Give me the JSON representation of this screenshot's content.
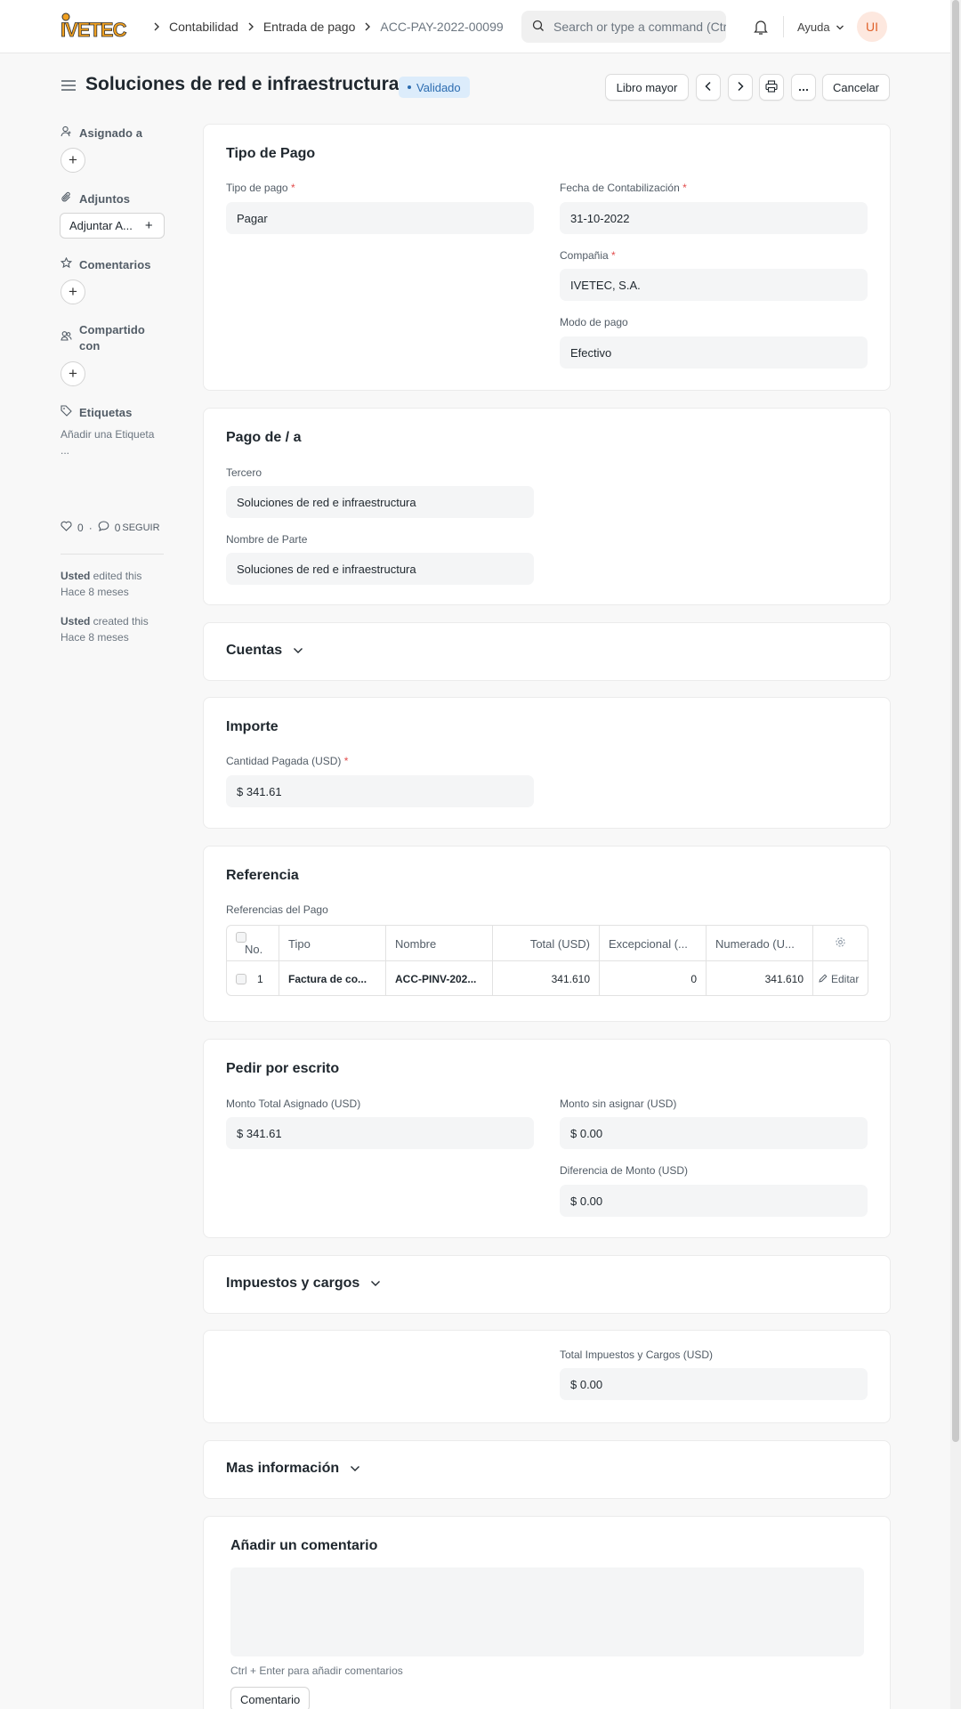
{
  "navbar": {
    "logo_text": "IVETEC",
    "breadcrumbs": [
      "Contabilidad",
      "Entrada de pago",
      "ACC-PAY-2022-00099"
    ],
    "search_placeholder": "Search or type a command (Ctrl + G)",
    "help_label": "Ayuda",
    "avatar_initials": "UI"
  },
  "header": {
    "title": "Soluciones de red e infraestructura",
    "status": "Validado",
    "ledger_button": "Libro mayor",
    "cancel_button": "Cancelar"
  },
  "sidebar": {
    "assigned_label": "Asignado a",
    "attachments_label": "Adjuntos",
    "attach_button": "Adjuntar A...",
    "comments_label": "Comentarios",
    "shared_label_1": "Compartido",
    "shared_label_2": "con",
    "tags_label": "Etiquetas",
    "add_tag_1": "Añadir una Etiqueta",
    "add_tag_2": "...",
    "likes": "0",
    "comments_count": "0",
    "follow": "SEGUIR",
    "activity": [
      {
        "who": "Usted",
        "what": " edited this",
        "when": "Hace 8 meses"
      },
      {
        "who": "Usted",
        "what": " created this",
        "when": "Hace 8 meses"
      }
    ]
  },
  "payment_type": {
    "title": "Tipo de Pago",
    "payment_type_label": "Tipo de pago",
    "payment_type_value": "Pagar",
    "posting_date_label": "Fecha de Contabilización",
    "posting_date_value": "31-10-2022",
    "company_label": "Compañia",
    "company_value": "IVETEC, S.A.",
    "mode_label": "Modo de pago",
    "mode_value": "Efectivo"
  },
  "party": {
    "title": "Pago de / a",
    "third_label": "Tercero",
    "third_value": "Soluciones de red e infraestructura",
    "party_name_label": "Nombre de Parte",
    "party_name_value": "Soluciones de red e infraestructura"
  },
  "accounts": {
    "title": "Cuentas"
  },
  "amount": {
    "title": "Importe",
    "paid_label": "Cantidad Pagada (USD)",
    "paid_value": "$ 341.61"
  },
  "reference": {
    "title": "Referencia",
    "table_label": "Referencias del Pago",
    "columns": [
      "No.",
      "Tipo",
      "Nombre",
      "Total (USD)",
      "Excepcional (...",
      "Numerado (U..."
    ],
    "rows": [
      {
        "no": "1",
        "tipo": "Factura de co...",
        "nombre": "ACC-PINV-202...",
        "total": "341.610",
        "excepcional": "0",
        "numerado": "341.610",
        "edit": "Editar"
      }
    ]
  },
  "writeoff": {
    "title": "Pedir por escrito",
    "allocated_label": "Monto Total Asignado (USD)",
    "allocated_value": "$ 341.61",
    "unallocated_label": "Monto sin asignar (USD)",
    "unallocated_value": "$ 0.00",
    "difference_label": "Diferencia de Monto (USD)",
    "difference_value": "$ 0.00"
  },
  "taxes": {
    "title": "Impuestos y cargos"
  },
  "totals": {
    "total_taxes_label": "Total Impuestos y Cargos (USD)",
    "total_taxes_value": "$ 0.00"
  },
  "more_info": {
    "title": "Mas información"
  },
  "comment": {
    "title": "Añadir un comentario",
    "hint": "Ctrl + Enter para añadir comentarios",
    "button": "Comentario"
  }
}
